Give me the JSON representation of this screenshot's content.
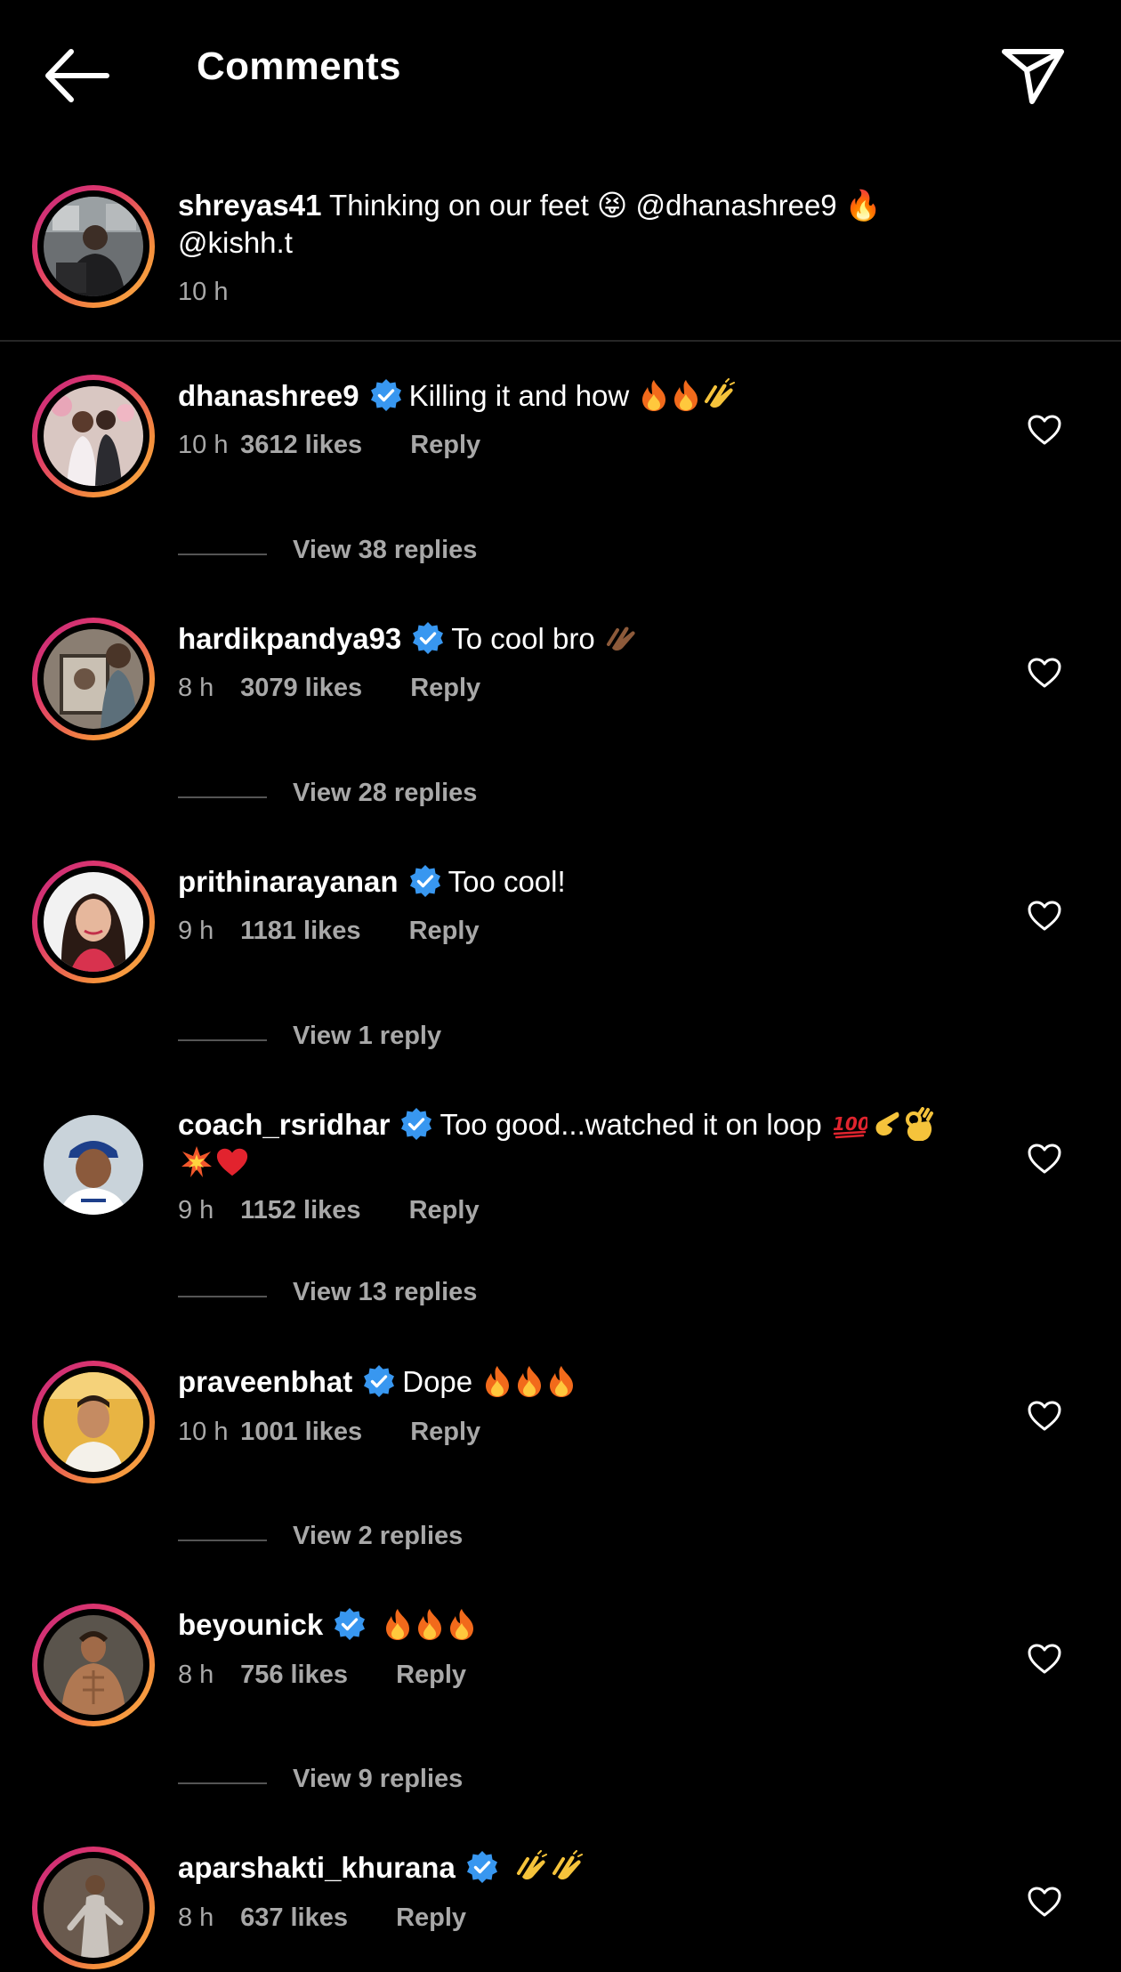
{
  "header": {
    "title": "Comments"
  },
  "caption": {
    "username": "shreyas41",
    "text": " Thinking on our feet 😝 @dhanashree9 🔥",
    "text_line2": "@kishh.t",
    "time": "10 h"
  },
  "comments": [
    {
      "username": "dhanashree9",
      "text": "Killing it and how",
      "time": "10 h",
      "likes": "3612 likes",
      "reply": "Reply",
      "view_replies": "View 38 replies"
    },
    {
      "username": "hardikpandya93",
      "text": "To cool bro",
      "time": "8 h",
      "likes": "3079 likes",
      "reply": "Reply",
      "view_replies": "View 28 replies"
    },
    {
      "username": "prithinarayanan",
      "text": "Too cool!",
      "time": "9 h",
      "likes": "1181 likes",
      "reply": "Reply",
      "view_replies": "View 1 reply"
    },
    {
      "username": "coach_rsridhar",
      "text": "Too good...watched it on loop",
      "time": "9 h",
      "likes": "1152 likes",
      "reply": "Reply",
      "view_replies": "View 13 replies"
    },
    {
      "username": "praveenbhat",
      "text": "Dope",
      "time": "10 h",
      "likes": "1001 likes",
      "reply": "Reply",
      "view_replies": "View 2 replies"
    },
    {
      "username": "beyounick",
      "text": "",
      "time": "8 h",
      "likes": "756 likes",
      "reply": "Reply",
      "view_replies": "View 9 replies"
    },
    {
      "username": "aparshakti_khurana",
      "text": "",
      "time": "8 h",
      "likes": "637 likes",
      "reply": "Reply"
    }
  ],
  "icons": {
    "back": "arrow-left-icon",
    "send": "paper-plane-icon",
    "verified": "verified-badge-icon",
    "like": "heart-outline-icon"
  },
  "colors": {
    "background": "#000000",
    "text": "#ffffff",
    "secondary_text": "#a8a8a8",
    "verified": "#3897f0",
    "story_ring_start": "#c52a7c",
    "story_ring_end": "#fbb24b"
  }
}
